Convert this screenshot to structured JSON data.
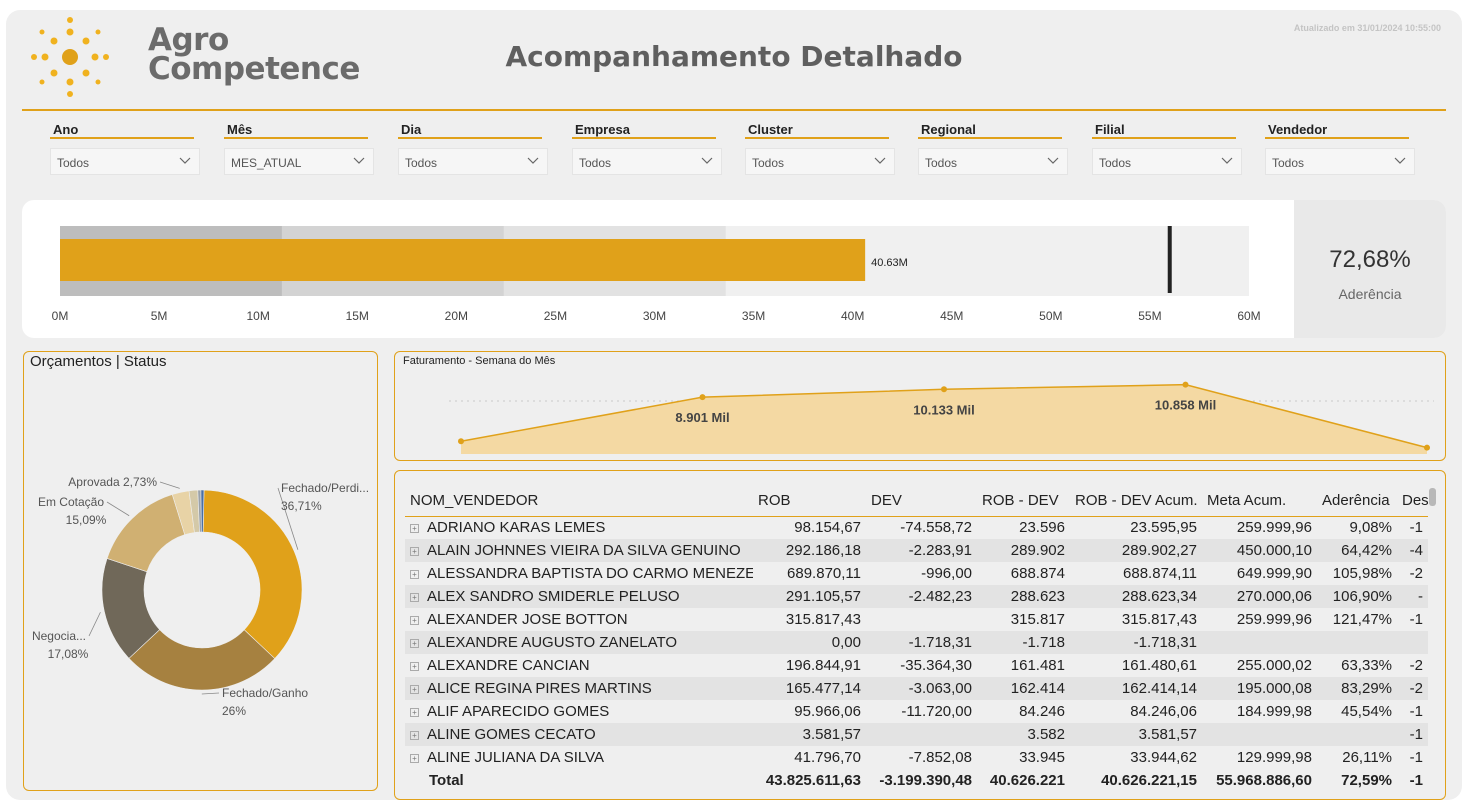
{
  "header": {
    "logo_line1": "Agro",
    "logo_line2": "Competence",
    "title": "Acompanhamento Detalhado",
    "updated": "Atualizado em 31/01/2024 10:55:00"
  },
  "filters": [
    {
      "label": "Ano",
      "value": "Todos"
    },
    {
      "label": "Mês",
      "value": "MES_ATUAL"
    },
    {
      "label": "Dia",
      "value": "Todos"
    },
    {
      "label": "Empresa",
      "value": "Todos"
    },
    {
      "label": "Cluster",
      "value": "Todos"
    },
    {
      "label": "Regional",
      "value": "Todos"
    },
    {
      "label": "Filial",
      "value": "Todos"
    },
    {
      "label": "Vendedor",
      "value": "Todos"
    }
  ],
  "kpi": {
    "value": "72,68%",
    "label": "Aderência"
  },
  "bullet_chart": {
    "type": "bullet",
    "value": 40.63,
    "value_label": "40.63M",
    "target": 56.0,
    "bands": [
      11.2,
      22.4,
      33.6,
      60
    ],
    "x_ticks": [
      "0M",
      "5M",
      "10M",
      "15M",
      "20M",
      "25M",
      "30M",
      "35M",
      "40M",
      "45M",
      "50M",
      "55M",
      "60M"
    ],
    "xlim": [
      0,
      60
    ],
    "colors": {
      "bar": "#e0a11a",
      "target": "#222222"
    }
  },
  "donut": {
    "title": "Orçamentos | Status",
    "type": "donut",
    "slices": [
      {
        "label": "Fechado/Perdi...",
        "pct_label": "36,71%",
        "value": 36.71,
        "color": "#e0a11a"
      },
      {
        "label": "Fechado/Ganho",
        "pct_label": "26%",
        "value": 26.0,
        "color": "#a68140"
      },
      {
        "label": "Negocia...",
        "pct_label": "17,08%",
        "value": 17.08,
        "color": "#706859"
      },
      {
        "label": "Em Cotação",
        "pct_label": "15,09%",
        "value": 15.09,
        "color": "#d0b072"
      },
      {
        "label": "Aprovada",
        "pct_label": "2,73%",
        "value": 2.73,
        "color": "#e8d3a6"
      },
      {
        "label": "",
        "pct_label": "",
        "value": 1.4,
        "color": "#d4c9a8"
      },
      {
        "label": "",
        "pct_label": "",
        "value": 0.5,
        "color": "#9aa1a8"
      },
      {
        "label": "",
        "pct_label": "",
        "value": 0.49,
        "color": "#4a6fa5"
      }
    ]
  },
  "chart_data": {
    "type": "area",
    "title": "Faturamento - Semana do Mês",
    "x": [
      1,
      2,
      3,
      4,
      5
    ],
    "values": [
      2.0,
      8.901,
      10.133,
      10.858,
      1.0
    ],
    "data_labels": [
      "",
      "8.901 Mil",
      "10.133 Mil",
      "10.858 Mil",
      ""
    ],
    "ylim": [
      0,
      13
    ],
    "colors": {
      "line": "#e0a11a",
      "fill": "#f4d9a3"
    }
  },
  "table": {
    "columns": [
      "NOM_VENDEDOR",
      "ROB",
      "DEV",
      "ROB - DEV",
      "ROB - DEV Acum.",
      "Meta Acum.",
      "Aderência",
      "Des"
    ],
    "rows": [
      [
        "ADRIANO KARAS LEMES",
        "98.154,67",
        "-74.558,72",
        "23.596",
        "23.595,95",
        "259.999,96",
        "9,08%",
        "-1"
      ],
      [
        "ALAIN JOHNNES VIEIRA DA SILVA GENUINO",
        "292.186,18",
        "-2.283,91",
        "289.902",
        "289.902,27",
        "450.000,10",
        "64,42%",
        "-4"
      ],
      [
        "ALESSANDRA BAPTISTA DO CARMO MENEZES",
        "689.870,11",
        "-996,00",
        "688.874",
        "688.874,11",
        "649.999,90",
        "105,98%",
        "-2"
      ],
      [
        "ALEX SANDRO SMIDERLE PELUSO",
        "291.105,57",
        "-2.482,23",
        "288.623",
        "288.623,34",
        "270.000,06",
        "106,90%",
        "-"
      ],
      [
        "ALEXANDER JOSE BOTTON",
        "315.817,43",
        "",
        "315.817",
        "315.817,43",
        "259.999,96",
        "121,47%",
        "-1"
      ],
      [
        "ALEXANDRE AUGUSTO ZANELATO",
        "0,00",
        "-1.718,31",
        "-1.718",
        "-1.718,31",
        "",
        "",
        ""
      ],
      [
        "ALEXANDRE CANCIAN",
        "196.844,91",
        "-35.364,30",
        "161.481",
        "161.480,61",
        "255.000,02",
        "63,33%",
        "-2"
      ],
      [
        "ALICE REGINA PIRES MARTINS",
        "165.477,14",
        "-3.063,00",
        "162.414",
        "162.414,14",
        "195.000,08",
        "83,29%",
        "-2"
      ],
      [
        "ALIF APARECIDO GOMES",
        "95.966,06",
        "-11.720,00",
        "84.246",
        "84.246,06",
        "184.999,98",
        "45,54%",
        "-1"
      ],
      [
        "ALINE GOMES CECATO",
        "3.581,57",
        "",
        "3.582",
        "3.581,57",
        "",
        "",
        "-1"
      ],
      [
        "ALINE JULIANA DA SILVA",
        "41.796,70",
        "-7.852,08",
        "33.945",
        "33.944,62",
        "129.999,98",
        "26,11%",
        "-1"
      ]
    ],
    "total": [
      "Total",
      "43.825.611,63",
      "-3.199.390,48",
      "40.626.221",
      "40.626.221,15",
      "55.968.886,60",
      "72,59%",
      "-1"
    ]
  }
}
